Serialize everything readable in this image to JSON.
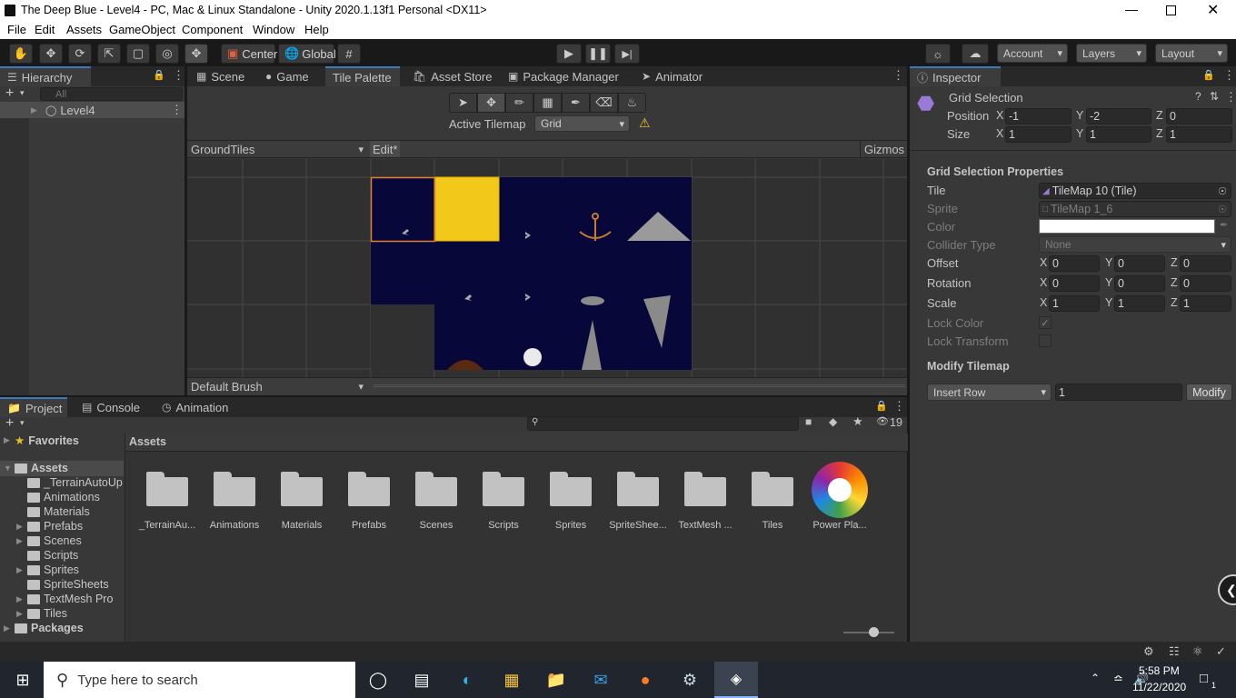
{
  "window": {
    "title": "The Deep Blue - Level4 - PC, Mac & Linux Standalone - Unity 2020.1.13f1 Personal <DX11>"
  },
  "menu": [
    "File",
    "Edit",
    "Assets",
    "GameObject",
    "Component",
    "Window",
    "Help"
  ],
  "toolbar": {
    "center": "Center",
    "global": "Global",
    "account": "Account",
    "layers": "Layers",
    "layout": "Layout"
  },
  "hierarchy": {
    "tab": "Hierarchy",
    "search_placeholder": "All",
    "root": "Level4"
  },
  "scene_tabs": [
    "Scene",
    "Game",
    "Tile Palette",
    "Asset Store",
    "Package Manager",
    "Animator"
  ],
  "tile_palette": {
    "active_tilemap_label": "Active Tilemap",
    "active_tilemap_value": "Grid",
    "palette": "GroundTiles",
    "edit": "Edit*",
    "gizmos": "Gizmos",
    "brush": "Default Brush"
  },
  "inspector": {
    "tab": "Inspector",
    "title": "Grid Selection",
    "position": {
      "label": "Position",
      "x": "-1",
      "y": "-2",
      "z": "0"
    },
    "size": {
      "label": "Size",
      "x": "1",
      "y": "1",
      "z": "1"
    },
    "props_header": "Grid Selection Properties",
    "tile": {
      "label": "Tile",
      "value": "TileMap 10 (Tile)"
    },
    "sprite": {
      "label": "Sprite",
      "value": "TileMap 1_6"
    },
    "color_label": "Color",
    "collider": {
      "label": "Collider Type",
      "value": "None"
    },
    "offset": {
      "label": "Offset",
      "x": "0",
      "y": "0",
      "z": "0"
    },
    "rotation": {
      "label": "Rotation",
      "x": "0",
      "y": "0",
      "z": "0"
    },
    "scale": {
      "label": "Scale",
      "x": "1",
      "y": "1",
      "z": "1"
    },
    "lock_color": "Lock Color",
    "lock_transform": "Lock Transform",
    "modify_header": "Modify Tilemap",
    "modify_mode": "Insert Row",
    "modify_count": "1",
    "modify_button": "Modify",
    "axis": {
      "x": "X",
      "y": "Y",
      "z": "Z"
    }
  },
  "project": {
    "tabs": [
      "Project",
      "Console",
      "Animation"
    ],
    "hidden_count": "19",
    "breadcrumb": "Assets",
    "tree": {
      "favorites": "Favorites",
      "assets": "Assets",
      "children": [
        "_TerrainAutoUp",
        "Animations",
        "Materials",
        "Prefabs",
        "Scenes",
        "Scripts",
        "Sprites",
        "SpriteSheets",
        "TextMesh Pro",
        "Tiles"
      ],
      "packages": "Packages"
    },
    "items": [
      "_TerrainAu...",
      "Animations",
      "Materials",
      "Prefabs",
      "Scenes",
      "Scripts",
      "Sprites",
      "SpriteShee...",
      "TextMesh ...",
      "Tiles",
      "Power Pla..."
    ]
  },
  "taskbar": {
    "search_placeholder": "Type here to search",
    "time": "5:58 PM",
    "date": "11/22/2020",
    "notif_count": "1"
  }
}
